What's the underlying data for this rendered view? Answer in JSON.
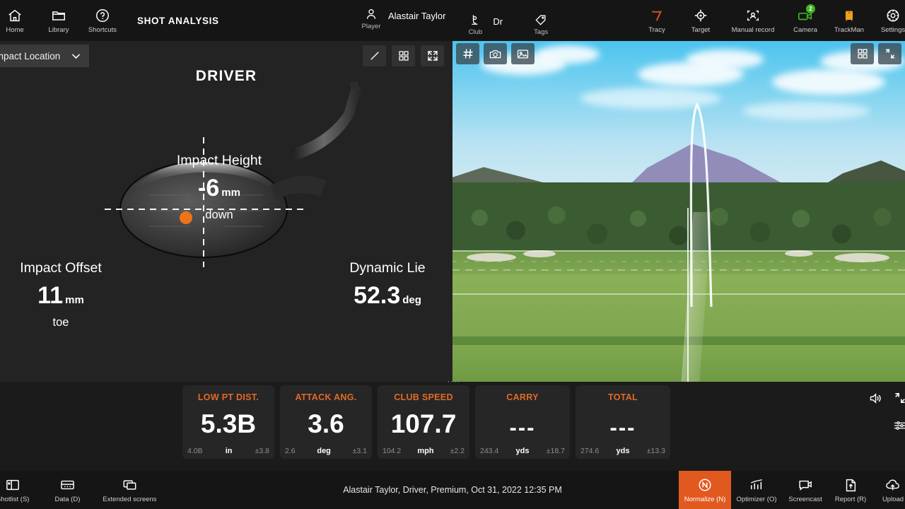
{
  "app": {
    "title": "SHOT ANALYSIS"
  },
  "topbar": {
    "nav": [
      {
        "label": "Home",
        "icon": "home-icon"
      },
      {
        "label": "Library",
        "icon": "folder-icon"
      },
      {
        "label": "Shortcuts",
        "icon": "question-circle-icon"
      }
    ],
    "player": {
      "label": "Player",
      "name": "Alastair Taylor",
      "icon": "person-icon"
    },
    "club": {
      "label": "Club",
      "value": "Dr",
      "icon": "club-icon"
    },
    "tags": {
      "label": "Tags",
      "icon": "tag-icon"
    },
    "right_items": [
      {
        "label": "Tracy",
        "icon": "tracy-icon",
        "color": "#c9542a"
      },
      {
        "label": "Target",
        "icon": "target-icon",
        "color": "#ffffff"
      },
      {
        "label": "Manual record",
        "icon": "manual-record-icon",
        "color": "#ffffff"
      },
      {
        "label": "Camera",
        "icon": "camera-icon",
        "color": "#3fb521",
        "badge": "2"
      },
      {
        "label": "TrackMan",
        "icon": "trackman-icon",
        "color": "#efa01f"
      },
      {
        "label": "Settings",
        "icon": "gear-icon",
        "color": "#ffffff"
      }
    ]
  },
  "left_panel": {
    "dropdown": {
      "label": "Impact Location",
      "icon": "chevron-down-icon"
    },
    "tools": [
      {
        "name": "line-tool",
        "icon": "line-icon"
      },
      {
        "name": "tiles-tool",
        "icon": "grid-icon"
      },
      {
        "name": "fullscreen-tool",
        "icon": "expand-icon"
      }
    ],
    "club_title": "DRIVER",
    "metrics": {
      "impact_height": {
        "label": "Impact Height",
        "value": "-6",
        "unit": "mm",
        "direction": "down"
      },
      "impact_offset": {
        "label": "Impact Offset",
        "value": "11",
        "unit": "mm",
        "direction": "toe"
      },
      "dynamic_lie": {
        "label": "Dynamic Lie",
        "value": "52.3",
        "unit": "deg"
      }
    },
    "impact_dot_color": "#ef7317"
  },
  "video_panel": {
    "tools_left": [
      {
        "name": "grid-overlay-tool",
        "icon": "hash-icon"
      },
      {
        "name": "snapshot-tool",
        "icon": "camera-icon"
      },
      {
        "name": "image-tool",
        "icon": "image-icon"
      }
    ],
    "tools_right": [
      {
        "name": "layout-tool",
        "icon": "grid-icon"
      },
      {
        "name": "collapse-tool",
        "icon": "collapse-icon"
      }
    ],
    "rail": [
      {
        "name": "volume-button",
        "icon": "speaker-icon"
      },
      {
        "name": "expand-button",
        "icon": "expand-icon"
      },
      {
        "name": "settings-sliders-button",
        "icon": "sliders-icon"
      }
    ]
  },
  "tiles": [
    {
      "title": "LOW PT DIST.",
      "value": "5.3B",
      "avg": "4.0B",
      "unit": "in",
      "dev": "±3.8"
    },
    {
      "title": "ATTACK ANG.",
      "value": "3.6",
      "avg": "2.6",
      "unit": "deg",
      "dev": "±3.1"
    },
    {
      "title": "CLUB SPEED",
      "value": "107.7",
      "avg": "104.2",
      "unit": "mph",
      "dev": "±2.2"
    },
    {
      "title": "CARRY",
      "value": "---",
      "avg": "243.4",
      "unit": "yds",
      "dev": "±18.7"
    },
    {
      "title": "TOTAL",
      "value": "---",
      "avg": "274.6",
      "unit": "yds",
      "dev": "±13.3"
    }
  ],
  "bottombar": {
    "left_items": [
      {
        "label": "Shotlist (S)",
        "icon": "shotlist-icon"
      },
      {
        "label": "Data (D)",
        "icon": "data-icon"
      },
      {
        "label": "Extended screens",
        "icon": "screens-icon"
      }
    ],
    "status": "Alastair Taylor, Driver, Premium, Oct 31, 2022 12:35 PM",
    "right_items": [
      {
        "label": "Normalize (N)",
        "icon": "normalize-icon",
        "active": true
      },
      {
        "label": "Optimizer (O)",
        "icon": "optimizer-icon",
        "active": false
      },
      {
        "label": "Screencast",
        "icon": "screencast-icon",
        "active": false
      },
      {
        "label": "Report (R)",
        "icon": "report-icon",
        "active": false
      },
      {
        "label": "Upload",
        "icon": "upload-icon",
        "active": false
      }
    ],
    "accent_color": "#e2591f"
  },
  "drag_handle": "····"
}
